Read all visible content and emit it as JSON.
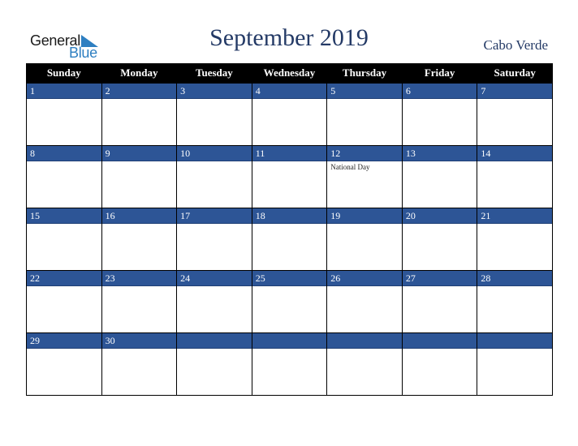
{
  "brand": {
    "line1": "General",
    "line2": "Blue",
    "accent_color": "#2e7fc1"
  },
  "header": {
    "title": "September 2019",
    "country": "Cabo Verde"
  },
  "colors": {
    "header_bg": "#000000",
    "date_bar": "#2d5596",
    "title": "#243a66"
  },
  "weekdays": [
    "Sunday",
    "Monday",
    "Tuesday",
    "Wednesday",
    "Thursday",
    "Friday",
    "Saturday"
  ],
  "weeks": [
    [
      {
        "d": "1"
      },
      {
        "d": "2"
      },
      {
        "d": "3"
      },
      {
        "d": "4"
      },
      {
        "d": "5"
      },
      {
        "d": "6"
      },
      {
        "d": "7"
      }
    ],
    [
      {
        "d": "8"
      },
      {
        "d": "9"
      },
      {
        "d": "10"
      },
      {
        "d": "11"
      },
      {
        "d": "12",
        "event": "National Day"
      },
      {
        "d": "13"
      },
      {
        "d": "14"
      }
    ],
    [
      {
        "d": "15"
      },
      {
        "d": "16"
      },
      {
        "d": "17"
      },
      {
        "d": "18"
      },
      {
        "d": "19"
      },
      {
        "d": "20"
      },
      {
        "d": "21"
      }
    ],
    [
      {
        "d": "22"
      },
      {
        "d": "23"
      },
      {
        "d": "24"
      },
      {
        "d": "25"
      },
      {
        "d": "26"
      },
      {
        "d": "27"
      },
      {
        "d": "28"
      }
    ],
    [
      {
        "d": "29"
      },
      {
        "d": "30"
      },
      {
        "d": ""
      },
      {
        "d": ""
      },
      {
        "d": ""
      },
      {
        "d": ""
      },
      {
        "d": ""
      }
    ]
  ]
}
